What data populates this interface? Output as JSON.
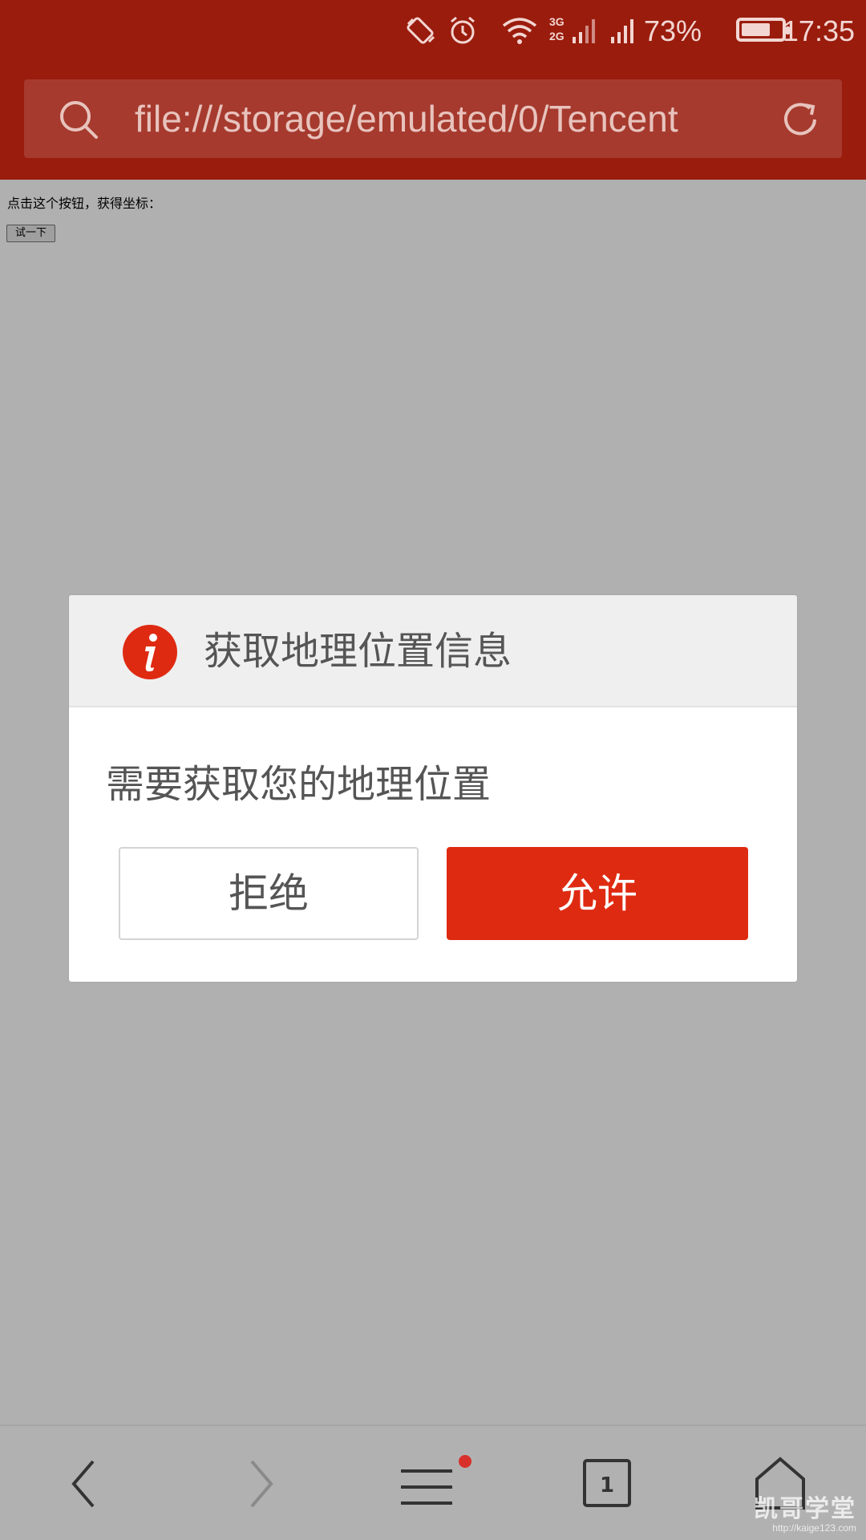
{
  "status_bar": {
    "time": "17:35",
    "battery_pct": "73%",
    "battery_level": 0.73,
    "network_top": "3G",
    "network_bottom": "2G",
    "icons": [
      "rotate-icon",
      "alarm-icon",
      "wifi-icon",
      "signal-icon",
      "signal-icon-2",
      "battery-icon"
    ]
  },
  "address_bar": {
    "url": "file:///storage/emulated/0/Tencent",
    "search_icon": "search-icon",
    "refresh_icon": "refresh-icon"
  },
  "page": {
    "prompt_text": "点击这个按钮，获得坐标：",
    "try_button": "试一下"
  },
  "dialog": {
    "title": "获取地理位置信息",
    "message": "需要获取您的地理位置",
    "deny_label": "拒绝",
    "allow_label": "允许",
    "icon": "info-icon",
    "accent_color": "#df2a12"
  },
  "bottom_nav": {
    "tab_count": "1",
    "items": [
      "back-icon",
      "forward-icon",
      "menu-icon",
      "tabs-icon",
      "home-icon"
    ]
  },
  "watermark": {
    "main": "凯哥学堂",
    "sub": "http://kaige123.com"
  },
  "colors": {
    "toolbar": "#9a1c0d",
    "overlay_bg": "#b1b1b1"
  }
}
